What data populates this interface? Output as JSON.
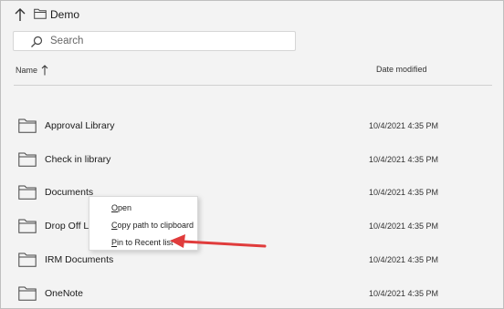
{
  "header": {
    "breadcrumb_label": "Demo",
    "up_icon": "arrow-up-icon",
    "folder_icon": "folder-icon"
  },
  "search": {
    "placeholder": "Search",
    "value": "",
    "icon": "search-icon"
  },
  "columns": {
    "name": "Name",
    "date": "Date modified",
    "sort": "ascending"
  },
  "rows": [
    {
      "name": "Approval Library",
      "date": "10/4/2021 4:35 PM"
    },
    {
      "name": "Check in library",
      "date": "10/4/2021 4:35 PM"
    },
    {
      "name": "Documents",
      "date": "10/4/2021 4:35 PM"
    },
    {
      "name": "Drop Off Li",
      "date": "10/4/2021 4:35 PM"
    },
    {
      "name": "IRM Documents",
      "date": "10/4/2021 4:35 PM"
    },
    {
      "name": "OneNote",
      "date": "10/4/2021 4:35 PM"
    }
  ],
  "context_menu": {
    "items": [
      {
        "label": "Open",
        "access_key": "O"
      },
      {
        "label": "Copy path to clipboard",
        "access_key": "C"
      },
      {
        "label": "Pin to Recent list",
        "access_key": "P"
      }
    ]
  },
  "colors": {
    "background": "#f3f3f3",
    "annotation_arrow": "#e03c3c",
    "folder_outline": "#444444"
  }
}
